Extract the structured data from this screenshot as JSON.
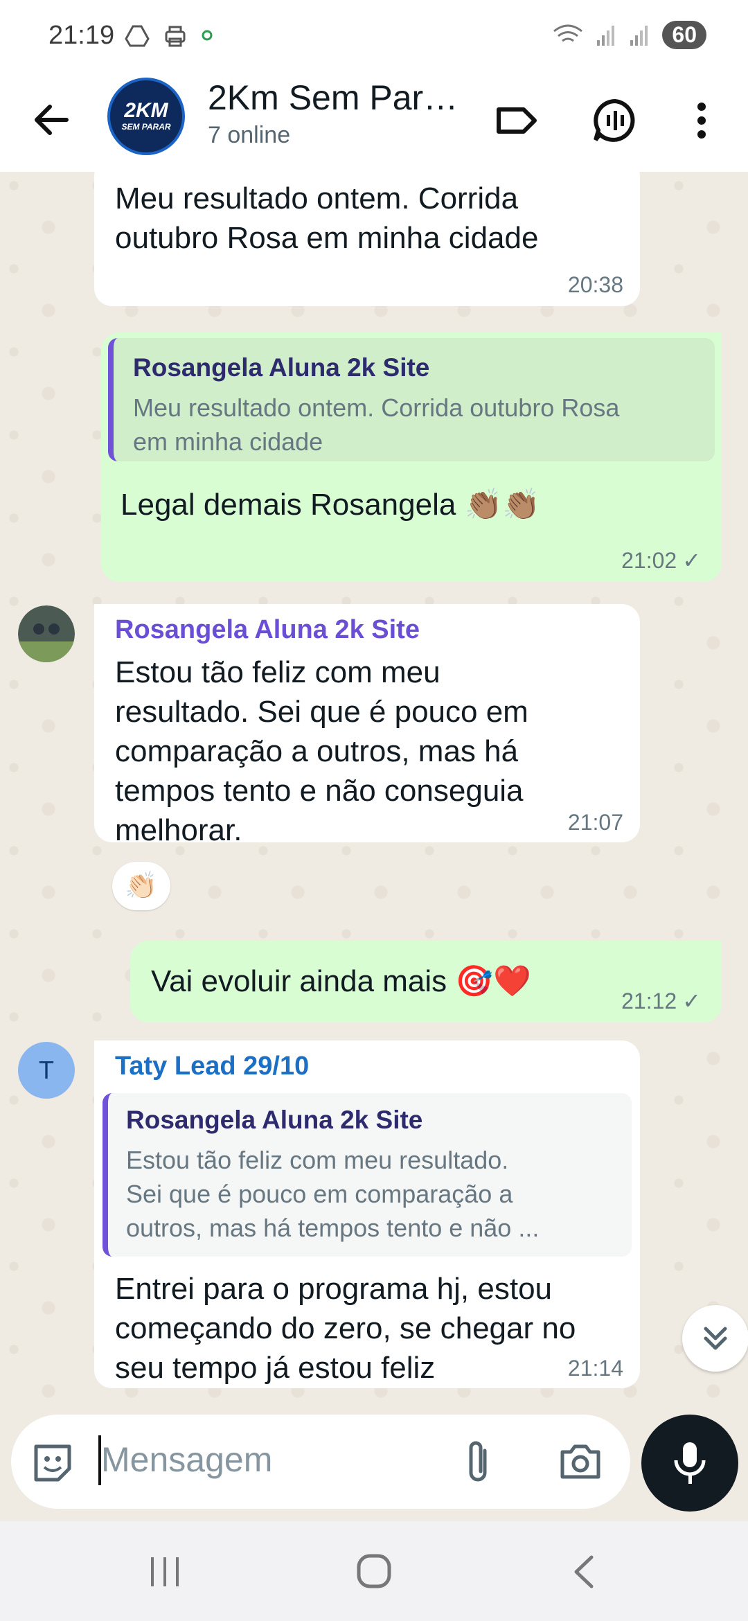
{
  "status_bar": {
    "time": "21:19",
    "battery": "60"
  },
  "header": {
    "group_name": "2Km Sem Para...",
    "status": "7 online",
    "avatar_line1": "2KM",
    "avatar_line2": "SEM PARAR"
  },
  "messages": [
    {
      "text_lines": [
        "Meu resultado ontem. Corrida",
        "outubro Rosa em minha cidade"
      ],
      "time": "20:38"
    },
    {
      "quote_name": "Rosangela Aluna 2k Site",
      "quote_lines": [
        "Meu resultado ontem. Corrida outubro Rosa",
        "em minha cidade"
      ],
      "text": "Legal demais Rosangela 👏🏽👏🏽",
      "time": "21:02"
    },
    {
      "sender": "Rosangela Aluna 2k Site",
      "text_lines": [
        "Estou tão feliz com meu",
        "resultado. Sei que é pouco em",
        "comparação a outros, mas há",
        "tempos tento e não conseguia",
        "melhorar."
      ],
      "time": "21:07",
      "reaction": "👏🏻"
    },
    {
      "text": "Vai evoluir ainda mais 🎯❤️",
      "time": "21:12"
    },
    {
      "sender": "Taty Lead 29/10",
      "sender_initial": "T",
      "quote_name": "Rosangela Aluna 2k Site",
      "quote_lines": [
        "Estou tão feliz com meu resultado.",
        "Sei que é pouco em comparação a",
        "outros, mas há tempos tento e não ..."
      ],
      "text_lines": [
        "Entrei para o programa hj, estou",
        "começando do zero, se chegar no",
        "seu tempo já estou feliz"
      ],
      "time": "21:14"
    }
  ],
  "composer": {
    "placeholder": "Mensagem"
  },
  "colors": {
    "outgoing": "#d9fdd3",
    "incoming": "#ffffff",
    "sender1": "#6a4fd6",
    "sender2": "#1b6fc4",
    "accent_quote": "#6f52d7"
  }
}
